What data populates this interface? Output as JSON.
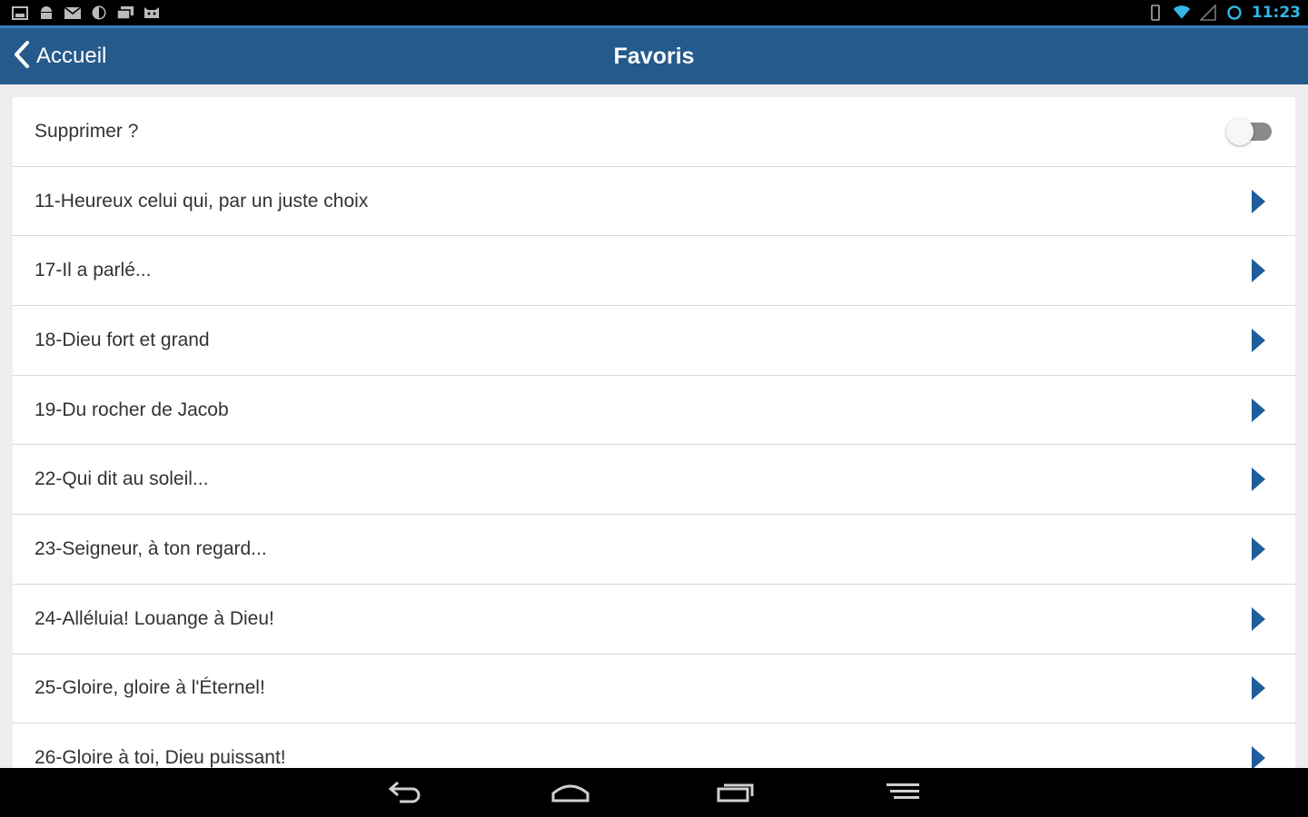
{
  "status_bar": {
    "left_icons": [
      "gallery-icon",
      "android-icon",
      "email-icon",
      "sync-icon",
      "photos-icon",
      "cat-icon"
    ],
    "right_icons": [
      "vibrate-icon",
      "wifi-icon",
      "signal-icon",
      "alarm-icon"
    ],
    "time": "11:23",
    "accent_color": "#33b5e5"
  },
  "action_bar": {
    "back_label": "Accueil",
    "title": "Favoris",
    "color": "#255a8c"
  },
  "delete_row": {
    "label": "Supprimer ?",
    "toggle_on": false
  },
  "favorites": [
    {
      "label": "11-Heureux celui qui, par un juste choix"
    },
    {
      "label": "17-Il a parlé..."
    },
    {
      "label": "18-Dieu fort et grand"
    },
    {
      "label": "19-Du rocher de Jacob"
    },
    {
      "label": "22-Qui dit au soleil..."
    },
    {
      "label": "23-Seigneur, à ton regard..."
    },
    {
      "label": "24-Alléluia! Louange à Dieu!"
    },
    {
      "label": "25-Gloire, gloire à l'Éternel!"
    },
    {
      "label": "26-Gloire à toi, Dieu puissant!"
    }
  ],
  "chevron_color": "#1f5e9c",
  "nav_bar": {
    "buttons": [
      "back-icon",
      "home-icon",
      "recent-apps-icon",
      "menu-icon"
    ]
  }
}
